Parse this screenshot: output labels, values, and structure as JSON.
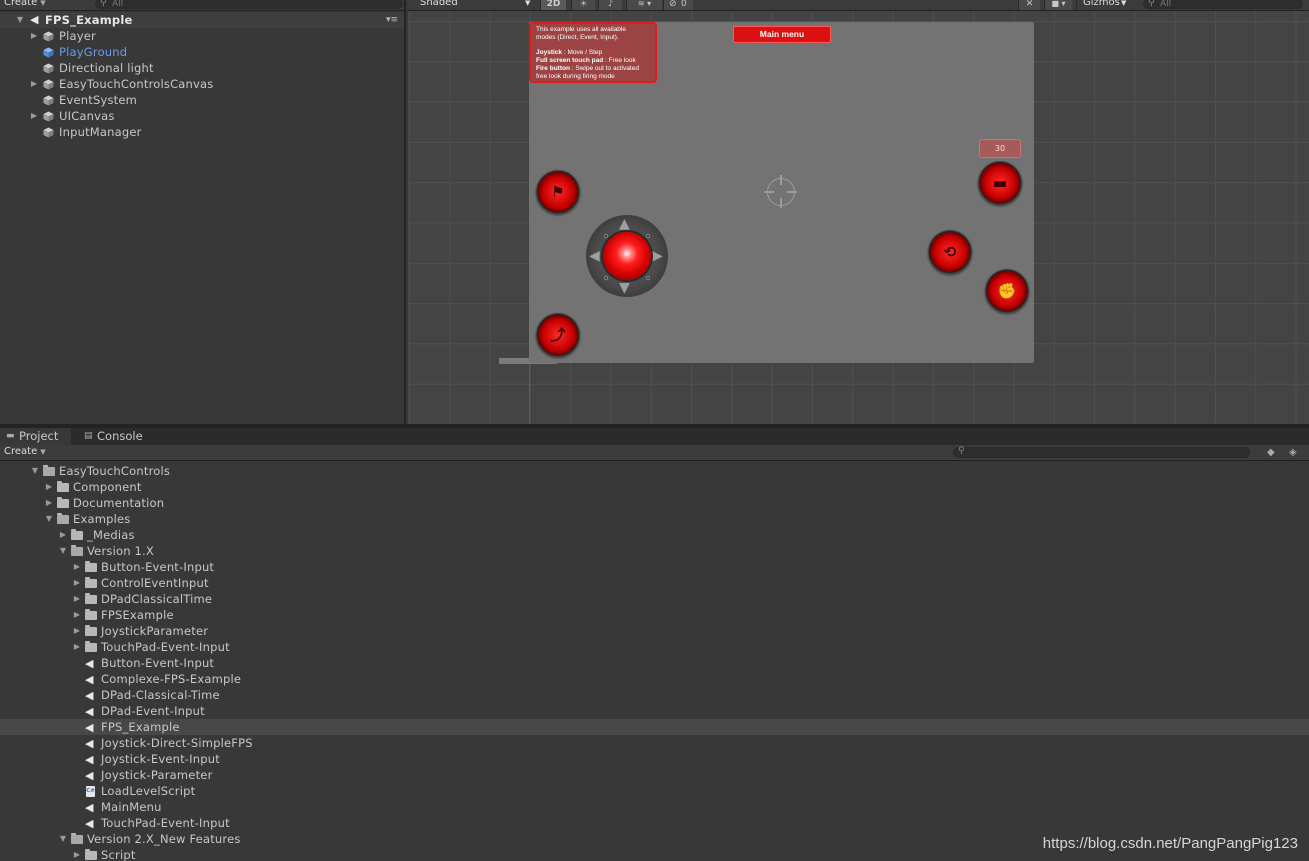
{
  "hierarchy": {
    "create_label": "Create",
    "search_placeholder": "All",
    "scene_name": "FPS_Example",
    "items": [
      {
        "label": "Player",
        "expandable": true,
        "highlight": false
      },
      {
        "label": "PlayGround",
        "expandable": false,
        "highlight": true
      },
      {
        "label": "Directional light",
        "expandable": false,
        "highlight": false
      },
      {
        "label": "EasyTouchControlsCanvas",
        "expandable": true,
        "highlight": false
      },
      {
        "label": "EventSystem",
        "expandable": false,
        "highlight": false
      },
      {
        "label": "UICanvas",
        "expandable": true,
        "highlight": false
      },
      {
        "label": "InputManager",
        "expandable": false,
        "highlight": false
      }
    ]
  },
  "scene_toolbar": {
    "shading_mode": "Shaded",
    "mode_2d": "2D",
    "hidden_count": "0",
    "gizmos_label": "Gizmos",
    "search_placeholder": "All"
  },
  "scene": {
    "info_text": {
      "line1": "This example uses all available",
      "line2": "modes (Direct, Event, Input).",
      "joystick_label": "Joystick",
      "joystick_desc": ": Move / Step",
      "touchpad_label": "Full screen touch pad",
      "touchpad_desc": ": Free look",
      "fire_label": "Fire button",
      "fire_desc": ": Swipe out  to activated",
      "fire_desc2": "free look during firing mode"
    },
    "main_menu_label": "Main menu",
    "ammo_count": "30"
  },
  "project": {
    "tabs": [
      {
        "label": "Project",
        "icon": "folder-icon",
        "active": true
      },
      {
        "label": "Console",
        "icon": "console-icon",
        "active": false
      }
    ],
    "create_label": "Create",
    "tree": [
      {
        "label": "EasyTouchControls",
        "depth": 0,
        "type": "folder",
        "state": "open"
      },
      {
        "label": "Component",
        "depth": 1,
        "type": "folder",
        "state": "closed"
      },
      {
        "label": "Documentation",
        "depth": 1,
        "type": "folder",
        "state": "closed"
      },
      {
        "label": "Examples",
        "depth": 1,
        "type": "folder",
        "state": "open"
      },
      {
        "label": "_Medias",
        "depth": 2,
        "type": "folder",
        "state": "closed"
      },
      {
        "label": "Version 1.X",
        "depth": 2,
        "type": "folder",
        "state": "open"
      },
      {
        "label": "Button-Event-Input",
        "depth": 3,
        "type": "folder",
        "state": "closed"
      },
      {
        "label": "ControlEventInput",
        "depth": 3,
        "type": "folder",
        "state": "closed"
      },
      {
        "label": "DPadClassicalTime",
        "depth": 3,
        "type": "folder",
        "state": "closed"
      },
      {
        "label": "FPSExample",
        "depth": 3,
        "type": "folder",
        "state": "closed"
      },
      {
        "label": "JoystickParameter",
        "depth": 3,
        "type": "folder",
        "state": "closed"
      },
      {
        "label": "TouchPad-Event-Input",
        "depth": 3,
        "type": "folder",
        "state": "closed"
      },
      {
        "label": "Button-Event-Input",
        "depth": 3,
        "type": "scene",
        "state": "none"
      },
      {
        "label": "Complexe-FPS-Example",
        "depth": 3,
        "type": "scene",
        "state": "none"
      },
      {
        "label": "DPad-Classical-Time",
        "depth": 3,
        "type": "scene",
        "state": "none"
      },
      {
        "label": "DPad-Event-Input",
        "depth": 3,
        "type": "scene",
        "state": "none"
      },
      {
        "label": "FPS_Example",
        "depth": 3,
        "type": "scene",
        "state": "none",
        "selected": true
      },
      {
        "label": "Joystick-Direct-SimpleFPS",
        "depth": 3,
        "type": "scene",
        "state": "none"
      },
      {
        "label": "Joystick-Event-Input",
        "depth": 3,
        "type": "scene",
        "state": "none"
      },
      {
        "label": "Joystick-Parameter",
        "depth": 3,
        "type": "scene",
        "state": "none"
      },
      {
        "label": "LoadLevelScript",
        "depth": 3,
        "type": "script",
        "state": "none"
      },
      {
        "label": "MainMenu",
        "depth": 3,
        "type": "scene",
        "state": "none"
      },
      {
        "label": "TouchPad-Event-Input",
        "depth": 3,
        "type": "scene",
        "state": "none"
      },
      {
        "label": "Version 2.X_New Features",
        "depth": 2,
        "type": "folder",
        "state": "open"
      },
      {
        "label": "Script",
        "depth": 3,
        "type": "folder",
        "state": "closed"
      }
    ]
  },
  "watermark": "https://blog.csdn.net/PangPangPig123",
  "colors": {
    "panel_bg": "#383838",
    "selected_row": "#484848",
    "highlight_text": "#6a9de8",
    "accent_red": "#dc1010"
  }
}
